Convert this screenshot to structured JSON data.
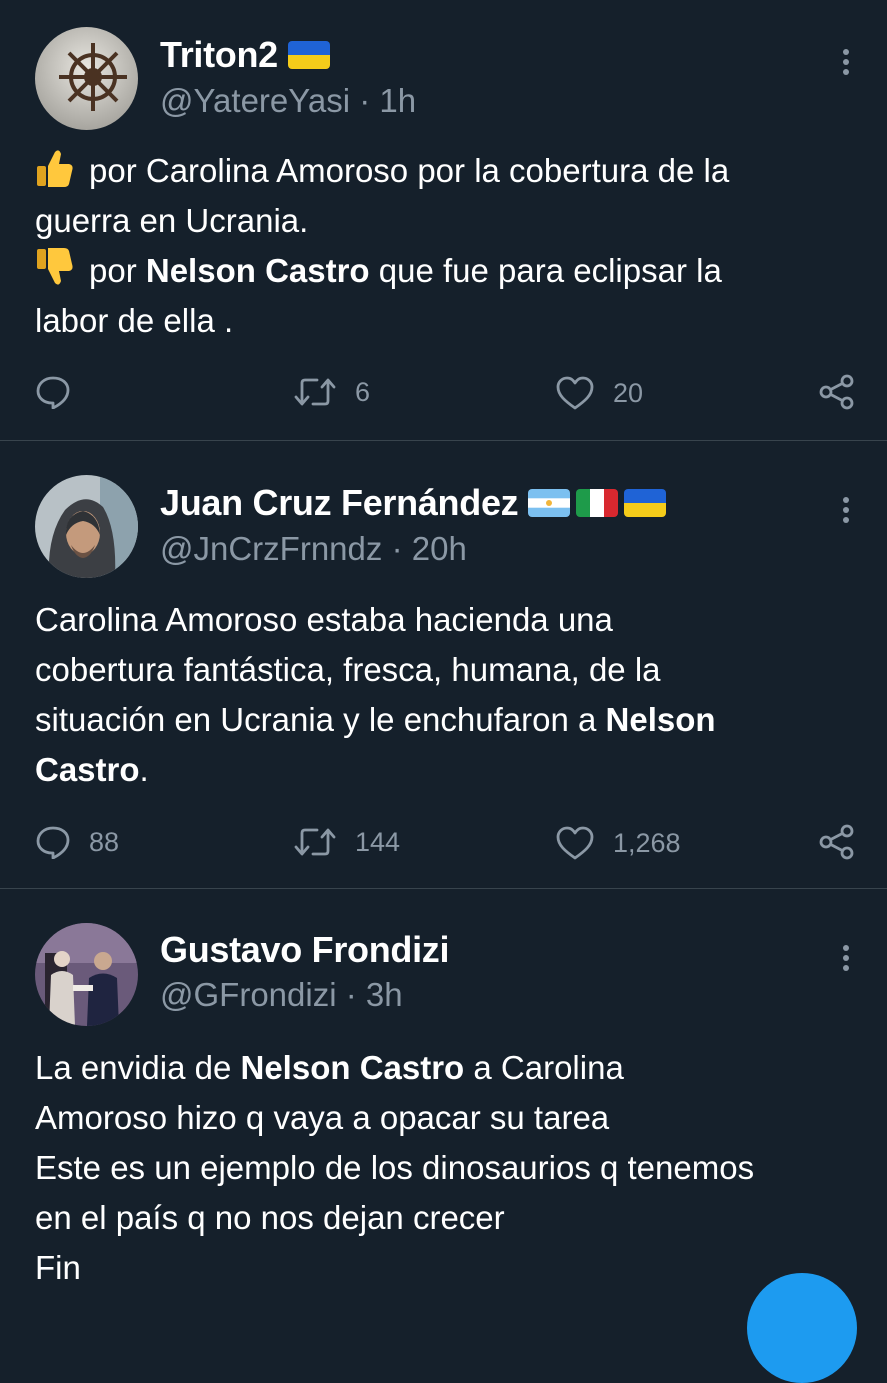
{
  "tweets": [
    {
      "name": "Triton2",
      "flags": [
        "ukraine"
      ],
      "handle": "@YatereYasi",
      "separator": "·",
      "time": "1h",
      "lines": [
        {
          "emoji": "thumbs-up",
          "segments": [
            {
              "text": "por Carolina Amoroso por la cobertura de la",
              "bold": false
            }
          ]
        },
        {
          "segments": [
            {
              "text": "guerra en Ucrania.",
              "bold": false
            }
          ]
        },
        {
          "emoji": "thumbs-down",
          "segments": [
            {
              "text": "por ",
              "bold": false
            },
            {
              "text": "Nelson Castro",
              "bold": true
            },
            {
              "text": " que fue para eclipsar la",
              "bold": false
            }
          ]
        },
        {
          "segments": [
            {
              "text": "labor de ella .",
              "bold": false
            }
          ]
        }
      ],
      "replies": "",
      "retweets": "6",
      "likes": "20"
    },
    {
      "name": "Juan Cruz Fernández",
      "flags": [
        "argentina",
        "italy",
        "ukraine"
      ],
      "handle": "@JnCrzFrnndz",
      "separator": "·",
      "time": "20h",
      "lines": [
        {
          "segments": [
            {
              "text": "Carolina Amoroso estaba hacienda una",
              "bold": false
            }
          ]
        },
        {
          "segments": [
            {
              "text": "cobertura fantástica, fresca, humana, de la",
              "bold": false
            }
          ]
        },
        {
          "segments": [
            {
              "text": "situación en Ucrania y le enchufaron a ",
              "bold": false
            },
            {
              "text": "Nelson",
              "bold": true
            }
          ]
        },
        {
          "segments": [
            {
              "text": "Castro",
              "bold": true
            },
            {
              "text": ".",
              "bold": false
            }
          ]
        }
      ],
      "replies": "88",
      "retweets": "144",
      "likes": "1,268"
    },
    {
      "name": "Gustavo Frondizi",
      "flags": [],
      "handle": "@GFrondizi",
      "separator": "·",
      "time": "3h",
      "lines": [
        {
          "segments": [
            {
              "text": "La envidia de ",
              "bold": false
            },
            {
              "text": "Nelson Castro",
              "bold": true
            },
            {
              "text": " a Carolina",
              "bold": false
            }
          ]
        },
        {
          "segments": [
            {
              "text": "Amoroso hizo q vaya a opacar su tarea",
              "bold": false
            }
          ]
        },
        {
          "segments": [
            {
              "text": "Este es un ejemplo de los dinosaurios q tenemos",
              "bold": false
            }
          ]
        },
        {
          "segments": [
            {
              "text": "en el país q no nos dejan crecer",
              "bold": false
            }
          ]
        },
        {
          "segments": [
            {
              "text": "Fin",
              "bold": false
            }
          ]
        }
      ]
    }
  ],
  "icons": {
    "reply": "reply-icon",
    "retweet": "retweet-icon",
    "like": "heart-icon",
    "share": "share-icon",
    "more": "more-dots-icon"
  },
  "colors": {
    "background": "#15202b",
    "text": "#ffffff",
    "secondary": "#8b98a5",
    "divider": "#38444d",
    "accent": "#1d9bf0"
  }
}
